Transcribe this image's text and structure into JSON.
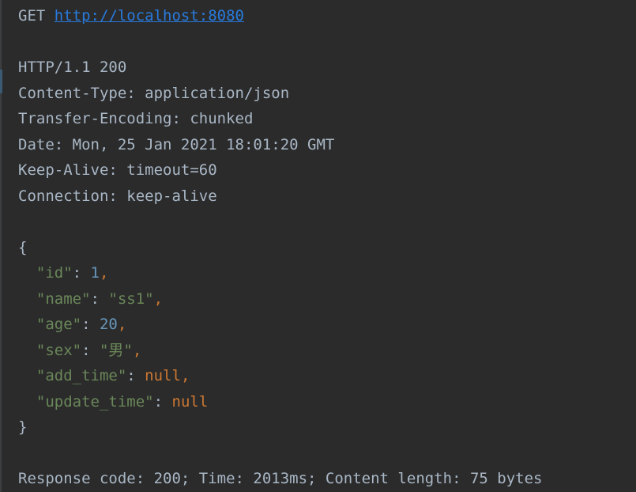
{
  "request": {
    "method": "GET",
    "url": "http://localhost:8080"
  },
  "response": {
    "status_line": "HTTP/1.1 200",
    "headers": [
      "Content-Type: application/json",
      "Transfer-Encoding: chunked",
      "Date: Mon, 25 Jan 2021 18:01:20 GMT",
      "Keep-Alive: timeout=60",
      "Connection: keep-alive"
    ],
    "body": {
      "open_brace": "{",
      "close_brace": "}",
      "fields": [
        {
          "key": "\"id\"",
          "value": "1",
          "type": "num",
          "comma": ","
        },
        {
          "key": "\"name\"",
          "value": "\"ss1\"",
          "type": "str",
          "comma": ","
        },
        {
          "key": "\"age\"",
          "value": "20",
          "type": "num",
          "comma": ","
        },
        {
          "key": "\"sex\"",
          "value": "\"男\"",
          "type": "str",
          "comma": ","
        },
        {
          "key": "\"add_time\"",
          "value": "null",
          "type": "kw",
          "comma": ","
        },
        {
          "key": "\"update_time\"",
          "value": "null",
          "type": "kw",
          "comma": ""
        }
      ]
    },
    "summary": "Response code: 200; Time: 2013ms; Content length: 75 bytes"
  },
  "colors": {
    "background": "#2b2b2b",
    "text": "#a9b7c6",
    "link": "#287bde",
    "json_key": "#6a8759",
    "json_string": "#6a8759",
    "json_number": "#6897bb",
    "json_keyword": "#cc7832"
  }
}
